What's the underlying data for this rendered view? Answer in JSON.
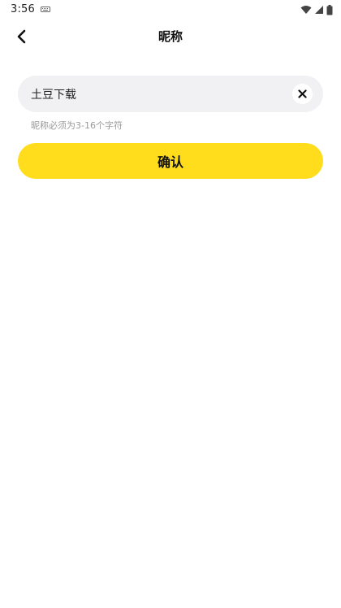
{
  "status_bar": {
    "time": "3:56",
    "icons": [
      "keyboard-icon",
      "wifi-icon",
      "signal-icon",
      "battery-icon"
    ]
  },
  "header": {
    "back_icon": "chevron-left-icon",
    "title": "昵称"
  },
  "form": {
    "nickname_value": "土豆下载",
    "clear_icon": "close-icon",
    "hint": "昵称必须为3-16个字符",
    "confirm_label": "确认"
  },
  "colors": {
    "accent": "#ffdd1d",
    "input_background": "#f1f1f3",
    "hint_text": "#9a9a9a"
  }
}
